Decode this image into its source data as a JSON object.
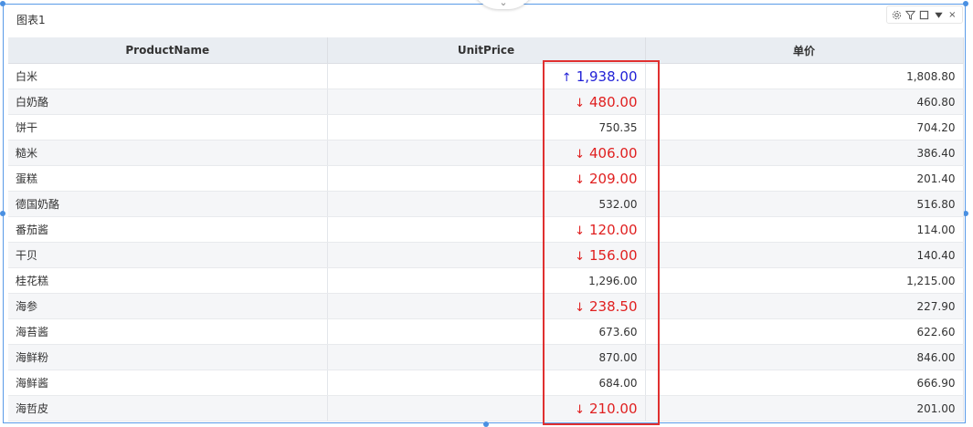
{
  "widget": {
    "title": "图表1",
    "collapse_glyph": "⌄",
    "toolbar": {
      "settings_icon": "gear-icon",
      "filter_icon": "filter-icon",
      "maximize_icon": "square-icon",
      "dropdown_icon": "triangle-down-icon",
      "close_glyph": "×"
    }
  },
  "table": {
    "columns": [
      "ProductName",
      "UnitPrice",
      "单价"
    ],
    "rows": [
      {
        "name": "白米",
        "unit_price": "1,938.00",
        "flag": "up",
        "price": "1,808.80"
      },
      {
        "name": "白奶酪",
        "unit_price": "480.00",
        "flag": "down",
        "price": "460.80"
      },
      {
        "name": "饼干",
        "unit_price": "750.35",
        "flag": "none",
        "price": "704.20"
      },
      {
        "name": "糙米",
        "unit_price": "406.00",
        "flag": "down",
        "price": "386.40"
      },
      {
        "name": "蛋糕",
        "unit_price": "209.00",
        "flag": "down",
        "price": "201.40"
      },
      {
        "name": "德国奶酪",
        "unit_price": "532.00",
        "flag": "none",
        "price": "516.80"
      },
      {
        "name": "番茄酱",
        "unit_price": "120.00",
        "flag": "down",
        "price": "114.00"
      },
      {
        "name": "干贝",
        "unit_price": "156.00",
        "flag": "down",
        "price": "140.40"
      },
      {
        "name": "桂花糕",
        "unit_price": "1,296.00",
        "flag": "none",
        "price": "1,215.00"
      },
      {
        "name": "海参",
        "unit_price": "238.50",
        "flag": "down",
        "price": "227.90"
      },
      {
        "name": "海苔酱",
        "unit_price": "673.60",
        "flag": "none",
        "price": "622.60"
      },
      {
        "name": "海鲜粉",
        "unit_price": "870.00",
        "flag": "none",
        "price": "846.00"
      },
      {
        "name": "海鲜酱",
        "unit_price": "684.00",
        "flag": "none",
        "price": "666.90"
      },
      {
        "name": "海哲皮",
        "unit_price": "210.00",
        "flag": "down",
        "price": "201.00"
      }
    ],
    "arrow_up": "↑",
    "arrow_down": "↓",
    "colors": {
      "up": "#1f1fd6",
      "down": "#e02020",
      "highlight_border": "#e03030"
    }
  }
}
